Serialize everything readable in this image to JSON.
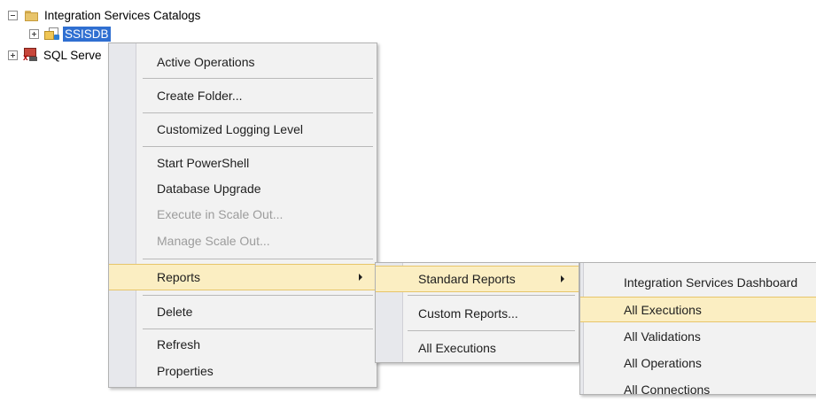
{
  "tree": {
    "catalogs_label": "Integration Services Catalogs",
    "ssisdb_label": "SSISDB",
    "sql_server_label": "SQL Serve"
  },
  "context_menu": {
    "active_operations": "Active Operations",
    "create_folder": "Create Folder...",
    "customized_logging_level": "Customized Logging Level",
    "start_powershell": "Start PowerShell",
    "database_upgrade": "Database Upgrade",
    "execute_in_scale_out": "Execute in Scale Out...",
    "manage_scale_out": "Manage Scale Out...",
    "reports": "Reports",
    "delete": "Delete",
    "refresh": "Refresh",
    "properties": "Properties"
  },
  "reports_submenu": {
    "standard_reports": "Standard Reports",
    "custom_reports": "Custom Reports...",
    "all_executions": "All Executions"
  },
  "standard_reports_submenu": {
    "items": [
      "Integration Services Dashboard",
      "All Executions",
      "All Validations",
      "All Operations",
      "All Connections"
    ]
  },
  "colors": {
    "highlight_fill": "#fbeec2",
    "highlight_border": "#e7c56a",
    "selection": "#2f6fd1",
    "menu_background": "#f2f2f2",
    "disabled_text": "#9c9c9c"
  }
}
